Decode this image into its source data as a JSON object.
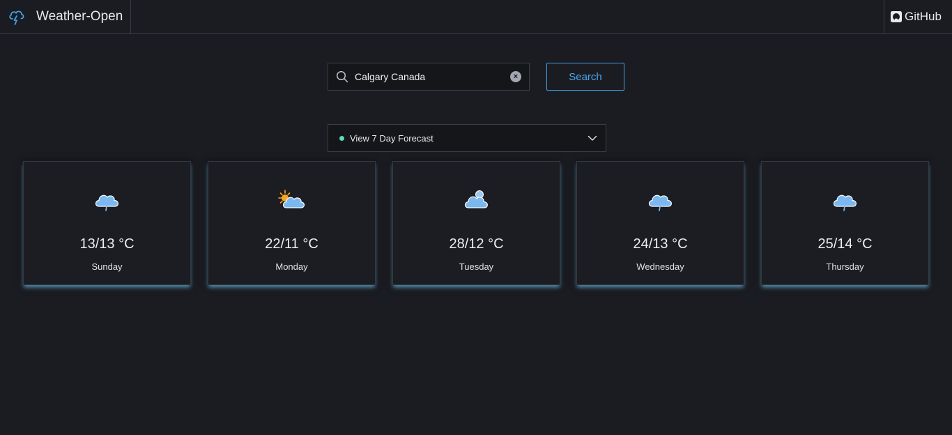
{
  "header": {
    "app_title": "Weather-Open",
    "github_label": "GitHub"
  },
  "search": {
    "value": "Calgary Canada",
    "button_label": "Search"
  },
  "forecast_select": {
    "selected": "View 7 Day Forecast"
  },
  "colors": {
    "accent": "#3ea0e8",
    "status_dot": "#5fd6c0",
    "cloud": "#7ab8ef",
    "sun": "#f5a623"
  },
  "days": [
    {
      "temp": "13/13 °C",
      "day": "Sunday",
      "icon": "rain-cloud-icon"
    },
    {
      "temp": "22/11 °C",
      "day": "Monday",
      "icon": "partly-sunny-icon"
    },
    {
      "temp": "28/12 °C",
      "day": "Tuesday",
      "icon": "cloudy-icon"
    },
    {
      "temp": "24/13 °C",
      "day": "Wednesday",
      "icon": "rain-cloud-icon"
    },
    {
      "temp": "25/14 °C",
      "day": "Thursday",
      "icon": "rain-cloud-icon"
    }
  ]
}
